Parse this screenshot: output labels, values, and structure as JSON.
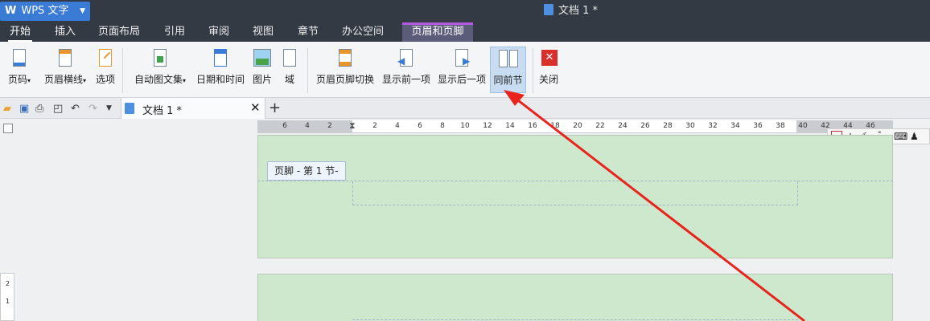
{
  "app": {
    "name": "WPS 文字",
    "document_title": "文档 1 *"
  },
  "tabs": [
    {
      "label": "开始"
    },
    {
      "label": "插入"
    },
    {
      "label": "页面布局"
    },
    {
      "label": "引用"
    },
    {
      "label": "审阅"
    },
    {
      "label": "视图"
    },
    {
      "label": "章节"
    },
    {
      "label": "办公空间"
    },
    {
      "label": "页眉和页脚"
    }
  ],
  "ribbon": {
    "page_number": "页码",
    "header_line": "页眉横线",
    "options": "选项",
    "auto_text": "自动图文集",
    "datetime": "日期和时间",
    "picture": "图片",
    "field": "域",
    "switch_hf": "页眉页脚切换",
    "show_prev": "显示前一项",
    "show_next": "显示后一项",
    "same_as_prev": "同前节",
    "close": "关闭"
  },
  "doc_tab": {
    "label": "文档 1 *",
    "close": "✕",
    "new": "+"
  },
  "ruler": {
    "left_ticks": [
      "6",
      "4",
      "2"
    ],
    "right_ticks": [
      "2",
      "4",
      "6",
      "8",
      "10",
      "12",
      "14",
      "16",
      "18",
      "20",
      "22",
      "24",
      "26",
      "28",
      "30",
      "32",
      "34",
      "36",
      "38",
      "40",
      "42",
      "44",
      "46"
    ]
  },
  "ime": {
    "wu": "五",
    "zhong": "中"
  },
  "footer": {
    "label": "页脚 - 第 1 节-"
  },
  "vruler": {
    "marks": [
      "2",
      "1"
    ]
  },
  "colors": {
    "accent": "#3a7bd5",
    "page_green": "#cde8cc",
    "arrow_red": "#e8241c"
  }
}
